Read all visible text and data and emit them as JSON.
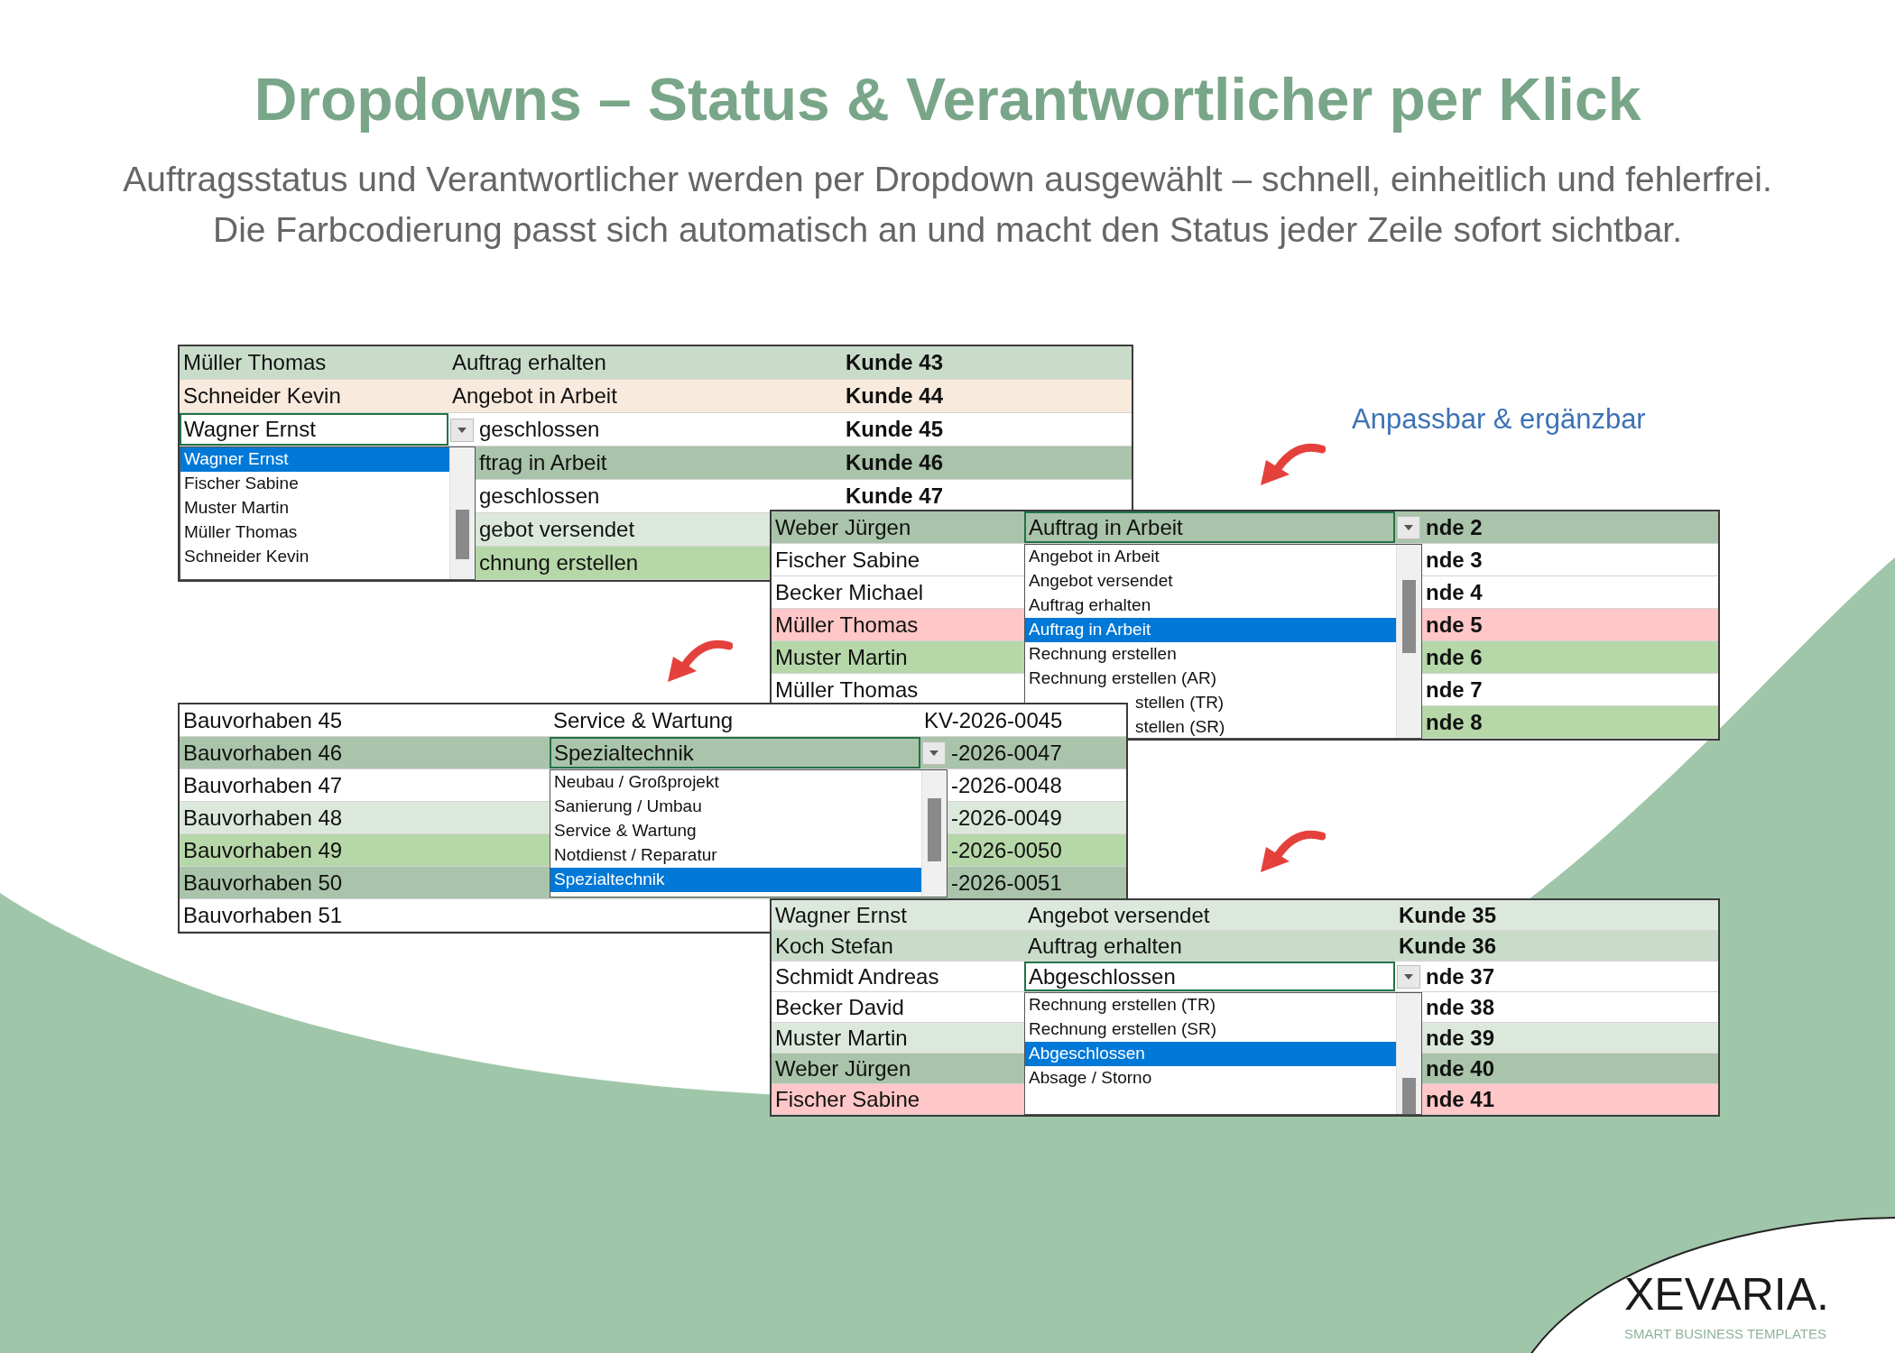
{
  "title": "Dropdowns – Status & Verantwortlicher per Klick",
  "subtitle": [
    "Auftragsstatus und Verantwortlicher werden per Dropdown ausgewählt – schnell, einheitlich und fehlerfrei.",
    "Die Farbcodierung passt sich automatisch an und macht den Status jeder Zeile sofort sichtbar."
  ],
  "note": "Anpassbar & ergänzbar",
  "panels": [
    {
      "rows": [
        {
          "cells": [
            "Müller Thomas",
            "Auftrag erhalten",
            "Kunde 43"
          ],
          "color": "#c9dcca",
          "selected": false
        },
        {
          "cells": [
            "Schneider Kevin",
            "Angebot in Arbeit",
            "Kunde 44"
          ],
          "color": "#f8eadd",
          "selected": false
        },
        {
          "cells": [
            "Wagner Ernst",
            "geschlossen",
            "Kunde 45"
          ],
          "color": "#ffffff",
          "selected": true
        },
        {
          "cells": [
            null,
            "ftrag in Arbeit",
            "Kunde 46"
          ],
          "color": "#a9c4aa",
          "selected": false
        },
        {
          "cells": [
            null,
            "geschlossen",
            "Kunde 47"
          ],
          "color": "#ffffff",
          "selected": false
        },
        {
          "cells": [
            null,
            "gebot versendet",
            null
          ],
          "color": "#dde8dd",
          "selected": false
        },
        {
          "cells": [
            null,
            "chnung erstellen",
            null
          ],
          "color": "#b6d7a8",
          "selected": false
        }
      ],
      "options": [
        {
          "label": "Wagner Ernst",
          "selected": true
        },
        {
          "label": "Fischer Sabine",
          "selected": false
        },
        {
          "label": "Muster Martin",
          "selected": false
        },
        {
          "label": "Müller Thomas",
          "selected": false
        },
        {
          "label": "Schneider Kevin",
          "selected": false
        }
      ]
    },
    {
      "rows": [
        {
          "cells": [
            "Weber Jürgen",
            "Auftrag in Arbeit",
            "nde 2"
          ],
          "color": "#a9c4aa",
          "selected": true
        },
        {
          "cells": [
            "Fischer Sabine",
            null,
            "nde 3"
          ],
          "color": "#ffffff",
          "selected": false
        },
        {
          "cells": [
            "Becker Michael",
            null,
            "nde 4"
          ],
          "color": "#ffffff",
          "selected": false
        },
        {
          "cells": [
            "Müller Thomas",
            null,
            "nde 5"
          ],
          "color": "#ffc7c7",
          "selected": false
        },
        {
          "cells": [
            "Muster Martin",
            null,
            "nde 6"
          ],
          "color": "#b6d7a8",
          "selected": false
        },
        {
          "cells": [
            "Müller Thomas",
            null,
            "nde 7"
          ],
          "color": "#ffffff",
          "selected": false
        },
        {
          "cells": [
            null,
            null,
            "nde 8"
          ],
          "color": "#b6d7a8",
          "selected": false
        }
      ],
      "options": [
        {
          "label": "Angebot in Arbeit",
          "selected": false
        },
        {
          "label": "Angebot versendet",
          "selected": false
        },
        {
          "label": "Auftrag erhalten",
          "selected": false
        },
        {
          "label": "Auftrag in Arbeit",
          "selected": true
        },
        {
          "label": "Rechnung erstellen",
          "selected": false
        },
        {
          "label": "Rechnung erstellen (AR)",
          "selected": false
        },
        {
          "label": "stellen (TR)",
          "selected": false
        },
        {
          "label": "stellen (SR)",
          "selected": false
        }
      ]
    },
    {
      "rows": [
        {
          "cells": [
            "Bauvorhaben 45",
            "Service & Wartung",
            "KV-2026-0045"
          ],
          "color": "#ffffff",
          "selected": false
        },
        {
          "cells": [
            "Bauvorhaben 46",
            "Spezialtechnik",
            "-2026-0047"
          ],
          "color": "#a9c4aa",
          "selected": true
        },
        {
          "cells": [
            "Bauvorhaben 47",
            null,
            "-2026-0048"
          ],
          "color": "#ffffff",
          "selected": false
        },
        {
          "cells": [
            "Bauvorhaben 48",
            null,
            "-2026-0049"
          ],
          "color": "#dde8dd",
          "selected": false
        },
        {
          "cells": [
            "Bauvorhaben 49",
            null,
            "-2026-0050"
          ],
          "color": "#b6d7a8",
          "selected": false
        },
        {
          "cells": [
            "Bauvorhaben 50",
            null,
            "-2026-0051"
          ],
          "color": "#a9c4aa",
          "selected": false
        },
        {
          "cells": [
            "Bauvorhaben 51",
            null,
            null
          ],
          "color": "#ffffff",
          "selected": false
        }
      ],
      "options": [
        {
          "label": "Neubau / Großprojekt",
          "selected": false
        },
        {
          "label": "Sanierung / Umbau",
          "selected": false
        },
        {
          "label": "Service & Wartung",
          "selected": false
        },
        {
          "label": "Notdienst / Reparatur",
          "selected": false
        },
        {
          "label": "Spezialtechnik",
          "selected": true
        }
      ]
    },
    {
      "rows": [
        {
          "cells": [
            "Wagner Ernst",
            "Angebot versendet",
            "Kunde 35"
          ],
          "color": "#dde8dd",
          "selected": false
        },
        {
          "cells": [
            "Koch Stefan",
            "Auftrag erhalten",
            "Kunde 36"
          ],
          "color": "#c9dcca",
          "selected": false
        },
        {
          "cells": [
            "Schmidt Andreas",
            "Abgeschlossen",
            "nde 37"
          ],
          "color": "#ffffff",
          "selected": true
        },
        {
          "cells": [
            "Becker David",
            null,
            "nde 38"
          ],
          "color": "#ffffff",
          "selected": false
        },
        {
          "cells": [
            "Muster Martin",
            null,
            "nde 39"
          ],
          "color": "#dde8dd",
          "selected": false
        },
        {
          "cells": [
            "Weber Jürgen",
            null,
            "nde 40"
          ],
          "color": "#a9c4aa",
          "selected": false
        },
        {
          "cells": [
            "Fischer Sabine",
            null,
            "nde 41"
          ],
          "color": "#ffc7c7",
          "selected": false
        }
      ],
      "options": [
        {
          "label": "Rechnung erstellen (TR)",
          "selected": false
        },
        {
          "label": "Rechnung erstellen (SR)",
          "selected": false
        },
        {
          "label": "Abgeschlossen",
          "selected": true
        },
        {
          "label": "Absage / Storno",
          "selected": false
        }
      ]
    }
  ],
  "logo": {
    "name": "XEVARIA.",
    "tagline": "SMART BUSINESS TEMPLATES"
  }
}
